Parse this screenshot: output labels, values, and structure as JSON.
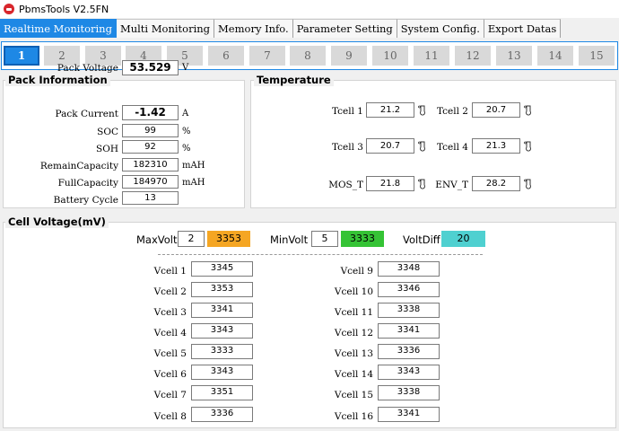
{
  "window": {
    "title": "PbmsTools V2.5FN"
  },
  "menu_tabs": [
    {
      "label": "Realtime Monitoring",
      "active": true
    },
    {
      "label": "Multi Monitoring"
    },
    {
      "label": "Memory Info."
    },
    {
      "label": "Parameter Setting"
    },
    {
      "label": "System Config."
    },
    {
      "label": "Export Datas"
    }
  ],
  "pack_numbers": [
    "1",
    "2",
    "3",
    "4",
    "5",
    "6",
    "7",
    "8",
    "9",
    "10",
    "11",
    "12",
    "13",
    "14",
    "15"
  ],
  "pack_info": {
    "title": "Pack Information",
    "rows": [
      {
        "label": "Pack Voltage",
        "value": "53.529",
        "unit": "V"
      },
      {
        "label": "Pack Current",
        "value": "-1.42",
        "unit": "A"
      },
      {
        "label": "SOC",
        "value": "99",
        "unit": "%"
      },
      {
        "label": "SOH",
        "value": "92",
        "unit": "%"
      },
      {
        "label": "RemainCapacity",
        "value": "182310",
        "unit": "mAH"
      },
      {
        "label": "FullCapacity",
        "value": "184970",
        "unit": "mAH"
      },
      {
        "label": "Battery Cycle",
        "value": "13",
        "unit": ""
      }
    ]
  },
  "temperature": {
    "title": "Temperature",
    "items": [
      {
        "label": "Tcell 1",
        "value": "21.2"
      },
      {
        "label": "Tcell 2",
        "value": "20.7"
      },
      {
        "label": "Tcell 3",
        "value": "20.7"
      },
      {
        "label": "Tcell 4",
        "value": "21.3"
      },
      {
        "label": "MOS_T",
        "value": "21.8"
      },
      {
        "label": "ENV_T",
        "value": "28.2"
      }
    ]
  },
  "cell_voltage": {
    "title": "Cell Voltage(mV)",
    "max_label": "MaxVolt",
    "max_index": "2",
    "max_value": "3353",
    "max_color": "#f5a623",
    "min_label": "MinVolt",
    "min_index": "5",
    "min_value": "3333",
    "min_color": "#35c335",
    "diff_label": "VoltDiff",
    "diff_value": "20",
    "diff_color": "#4fd0d0",
    "cells": [
      {
        "label": "Vcell 1",
        "value": "3345"
      },
      {
        "label": "Vcell 2",
        "value": "3353"
      },
      {
        "label": "Vcell 3",
        "value": "3341"
      },
      {
        "label": "Vcell 4",
        "value": "3343"
      },
      {
        "label": "Vcell 5",
        "value": "3333"
      },
      {
        "label": "Vcell 6",
        "value": "3343"
      },
      {
        "label": "Vcell 7",
        "value": "3351"
      },
      {
        "label": "Vcell 8",
        "value": "3336"
      },
      {
        "label": "Vcell 9",
        "value": "3348"
      },
      {
        "label": "Vcell 10",
        "value": "3346"
      },
      {
        "label": "Vcell 11",
        "value": "3338"
      },
      {
        "label": "Vcell 12",
        "value": "3341"
      },
      {
        "label": "Vcell 13",
        "value": "3336"
      },
      {
        "label": "Vcell 14",
        "value": "3343"
      },
      {
        "label": "Vcell 15",
        "value": "3338"
      },
      {
        "label": "Vcell 16",
        "value": "3341"
      }
    ]
  },
  "icons": {
    "app": "battery-logo-icon",
    "temperature": "thermometer-icon"
  }
}
